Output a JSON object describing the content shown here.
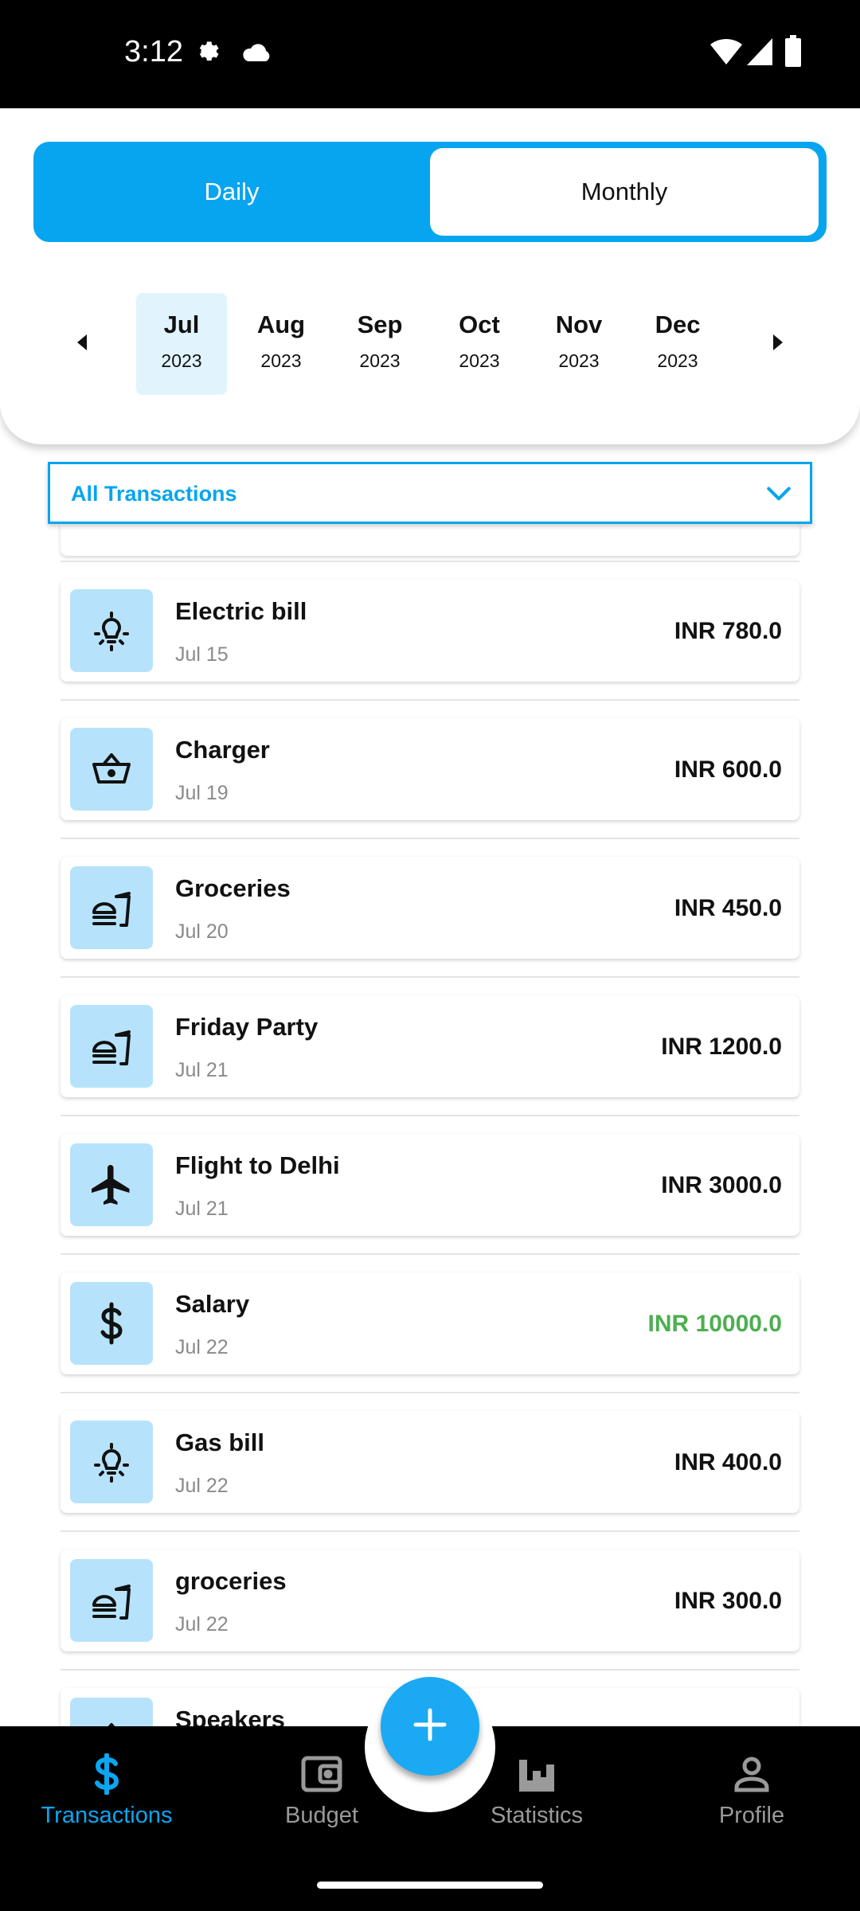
{
  "status_bar": {
    "time": "3:12"
  },
  "view_toggle": {
    "daily_label": "Daily",
    "monthly_label": "Monthly",
    "selected": "Daily"
  },
  "months": [
    {
      "month": "Jul",
      "year": "2023",
      "selected": true
    },
    {
      "month": "Aug",
      "year": "2023"
    },
    {
      "month": "Sep",
      "year": "2023"
    },
    {
      "month": "Oct",
      "year": "2023"
    },
    {
      "month": "Nov",
      "year": "2023"
    },
    {
      "month": "Dec",
      "year": "2023"
    }
  ],
  "filter": {
    "value": "All Transactions"
  },
  "transactions": [
    {
      "title": "Electric bill",
      "date": "Jul 15",
      "amount": "INR 780.0",
      "icon": "bulb-icon",
      "type": "expense"
    },
    {
      "title": "Charger",
      "date": "Jul 19",
      "amount": "INR 600.0",
      "icon": "basket-icon",
      "type": "expense"
    },
    {
      "title": "Groceries",
      "date": "Jul 20",
      "amount": "INR 450.0",
      "icon": "fastfood-icon",
      "type": "expense"
    },
    {
      "title": "Friday Party",
      "date": "Jul 21",
      "amount": "INR 1200.0",
      "icon": "fastfood-icon",
      "type": "expense"
    },
    {
      "title": "Flight to Delhi",
      "date": "Jul 21",
      "amount": "INR 3000.0",
      "icon": "airplane-icon",
      "type": "expense"
    },
    {
      "title": "Salary",
      "date": "Jul 22",
      "amount": "INR 10000.0",
      "icon": "dollar-icon",
      "type": "income"
    },
    {
      "title": "Gas bill",
      "date": "Jul 22",
      "amount": "INR 400.0",
      "icon": "bulb-icon",
      "type": "expense"
    },
    {
      "title": "groceries",
      "date": "Jul 22",
      "amount": "INR 300.0",
      "icon": "fastfood-icon",
      "type": "expense"
    },
    {
      "title": "Speakers",
      "date": "",
      "amount": "",
      "icon": "basket-icon",
      "type": "expense"
    }
  ],
  "bottom_nav": {
    "items": [
      {
        "label": "Transactions",
        "icon": "dollar-icon",
        "active": true
      },
      {
        "label": "Budget",
        "icon": "wallet-icon"
      },
      {
        "label": "Statistics",
        "icon": "bar-chart-icon"
      },
      {
        "label": "Profile",
        "icon": "person-icon"
      }
    ],
    "fab_icon": "plus-icon"
  },
  "colors": {
    "accent": "#07a5ef",
    "icon_bg": "#b6e3fb",
    "income": "#4caf50",
    "selected_month_bg": "#e1f4fd"
  }
}
